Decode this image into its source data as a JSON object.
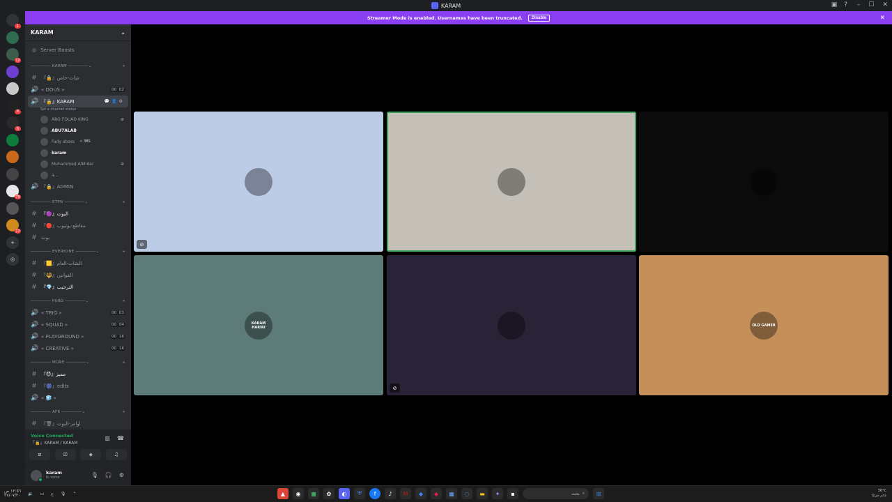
{
  "window": {
    "title": "KARAM"
  },
  "banner": {
    "text": "Streamer Mode is enabled. Usernames have been truncated.",
    "disable_label": "Disable"
  },
  "guild_rail": [
    {
      "icon": "discord-home-icon",
      "badge": "1",
      "color": "#313338"
    },
    {
      "icon": "server-karam-icon",
      "badge": "",
      "color": "#2f6b4f"
    },
    {
      "icon": "server-icon",
      "badge": "12",
      "color": "#3d5c4b"
    },
    {
      "icon": "server-icon",
      "badge": "",
      "color": "#6e3fd1"
    },
    {
      "icon": "server-icon",
      "badge": "",
      "color": "#c8c8c8"
    },
    {
      "icon": "server-icon",
      "badge": "8",
      "color": "#222"
    },
    {
      "icon": "server-icon",
      "badge": "6",
      "color": "#2a2a2a"
    },
    {
      "icon": "server-icon",
      "badge": "",
      "color": "#0e7c3a"
    },
    {
      "icon": "server-icon",
      "badge": "",
      "color": "#c96a1a"
    },
    {
      "icon": "server-icon",
      "badge": "",
      "color": "#444"
    },
    {
      "icon": "server-icon",
      "badge": "79",
      "color": "#e7e7e7"
    },
    {
      "icon": "server-icon",
      "badge": "",
      "color": "#555"
    },
    {
      "icon": "server-icon",
      "badge": "17",
      "color": "#d08a1e"
    }
  ],
  "server": {
    "name": "KARAM",
    "boosts_label": "Server Boosts"
  },
  "categories": {
    "karam": "KARAM",
    "etpn": "ETPN",
    "everyone": "EVERYONE",
    "pubg": "PUBG",
    "more": "MORE",
    "afk": "AFK"
  },
  "channels": {
    "shat_khas": "『🔒』شات-خاص",
    "dous": "« DOUS »",
    "dous_limit": [
      "00",
      "02"
    ],
    "karam_voice": "『🔒』KARAM",
    "karam_status": "Set a channel status",
    "admin": "『🔒』ADMIN",
    "albot": "『🟣』البوت",
    "maqate": "『🔴』مقاطع-يوتيوب",
    "bot2": "بوت",
    "shat_amm": "『🟨』الشات-العام",
    "qawanin": "『🔱』القوانين",
    "tarheeb": "『💎』الترحيب",
    "trio": "« TRIO »",
    "trio_limit": [
      "00",
      "03"
    ],
    "squad": "« SQUAD »",
    "squad_limit": [
      "00",
      "04"
    ],
    "playground": "« PLAYGROUND »",
    "playground_limit": [
      "00",
      "16"
    ],
    "creative": "« CREATIVE »",
    "creative_limit": [
      "00",
      "16"
    ],
    "mumayaz": "『😈』مميز",
    "edits": "『🎆』edits",
    "emoji_ch": "« 🧊 »",
    "awamer": "『🗑』اوامر-البوت"
  },
  "members": [
    {
      "name": "ABO FOUAD KING",
      "muted": true,
      "bright": false,
      "tag": ""
    },
    {
      "name": "ABU7ALAB",
      "muted": false,
      "bright": true,
      "tag": ""
    },
    {
      "name": "Fady abass",
      "muted": false,
      "bright": false,
      "tag": "✧ 3BS"
    },
    {
      "name": "karam",
      "muted": false,
      "bright": true,
      "tag": ""
    },
    {
      "name": "Muhammed Alkhder",
      "muted": true,
      "bright": false,
      "tag": ""
    },
    {
      "name": "a...",
      "muted": false,
      "bright": false,
      "tag": ""
    }
  ],
  "voice": {
    "status": "Voice Connected",
    "channel": "『🔒』KARAM / KARAM"
  },
  "user": {
    "name": "karam",
    "sub": "In voice"
  },
  "tiles": [
    {
      "bg": "#bccbe6",
      "speaking": false,
      "muted": true,
      "label": ""
    },
    {
      "bg": "#c4c0b8",
      "speaking": true,
      "muted": false,
      "label": ""
    },
    {
      "bg": "#0b0b0b",
      "speaking": false,
      "muted": false,
      "label": ""
    },
    {
      "bg": "#5d7b78",
      "speaking": false,
      "muted": false,
      "label": "KARAM HARIRI"
    },
    {
      "bg": "#2a2236",
      "speaking": false,
      "muted": true,
      "label": ""
    },
    {
      "bg": "#c58f5a",
      "speaking": false,
      "muted": false,
      "label": "OLD GAMER"
    }
  ],
  "taskbar": {
    "search_placeholder": "بحث",
    "weather": "36°C",
    "weather_desc": "غائم جزئيًا",
    "time": "١٢:٥٦ ص",
    "date": "٢٧/٠٧/٢٠",
    "lang": "ع"
  }
}
